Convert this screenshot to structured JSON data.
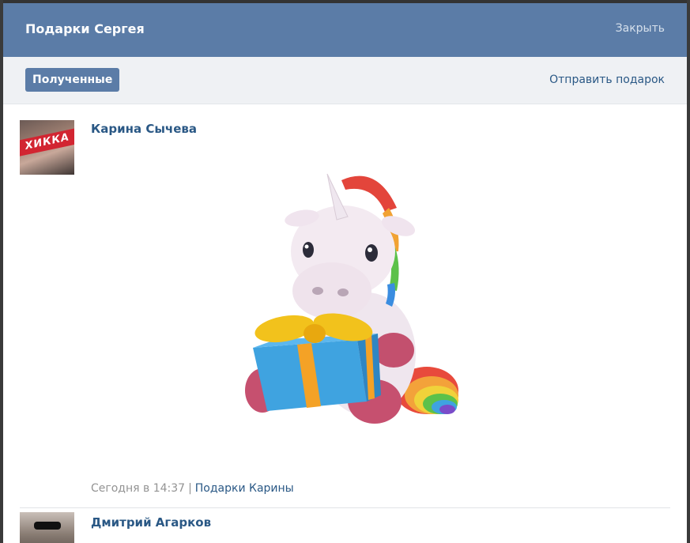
{
  "modal": {
    "title": "Подарки Сергея",
    "close_label": "Закрыть"
  },
  "tabs": {
    "received_label": "Полученные",
    "send_gift_label": "Отправить подарок"
  },
  "gifts": [
    {
      "sender": "Карина Сычева",
      "avatar_text": "ХИККА",
      "gift_icon": "unicorn-with-gift",
      "date": "Сегодня в 14:37",
      "separator": "|",
      "gifts_link": "Подарки Карины"
    },
    {
      "sender": "Дмитрий Агарков"
    }
  ],
  "colors": {
    "header_bg": "#5b7ca7",
    "link": "#2a5885",
    "tabs_bg": "#eff1f4"
  }
}
